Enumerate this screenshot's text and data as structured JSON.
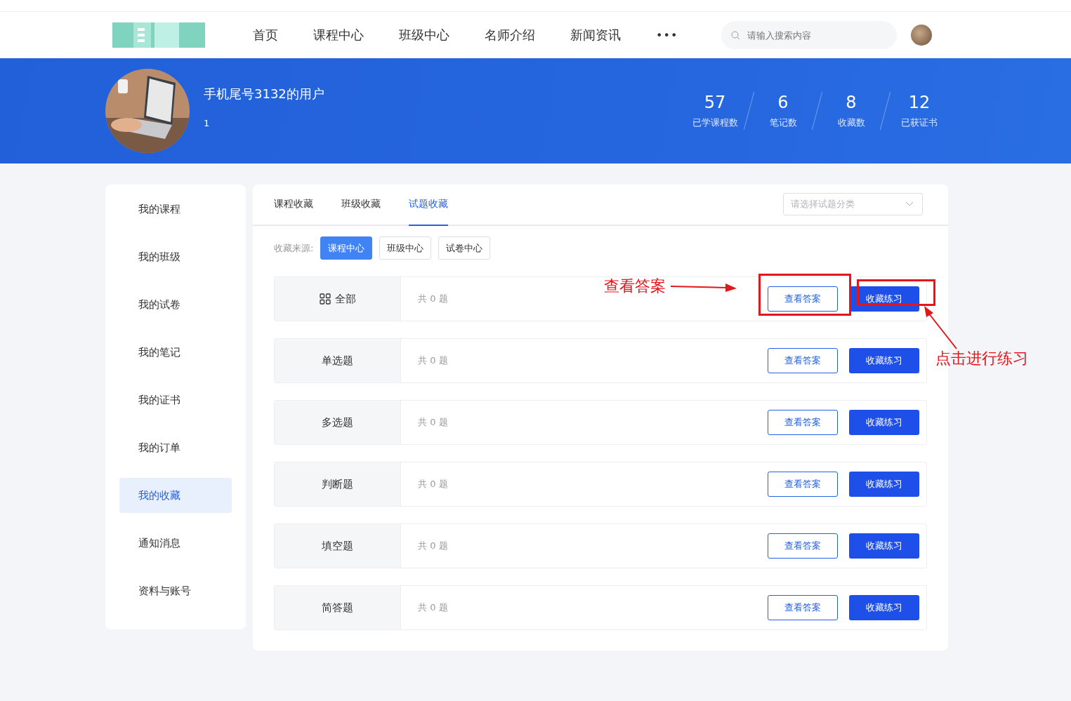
{
  "nav": {
    "items": [
      {
        "label": "首页",
        "selected": false
      },
      {
        "label": "课程中心",
        "selected": false
      },
      {
        "label": "班级中心",
        "selected": false
      },
      {
        "label": "名师介绍",
        "selected": false
      },
      {
        "label": "新闻资讯",
        "selected": false
      }
    ],
    "more": "•••",
    "search_placeholder": "请输入搜索内容"
  },
  "profile": {
    "name": "手机尾号3132的用户",
    "sub": "1",
    "stats": [
      {
        "value": "57",
        "label": "已学课程数"
      },
      {
        "value": "6",
        "label": "笔记数"
      },
      {
        "value": "8",
        "label": "收藏数"
      },
      {
        "value": "12",
        "label": "已获证书"
      }
    ]
  },
  "sidebar": [
    {
      "label": "我的课程",
      "selected": false
    },
    {
      "label": "我的班级",
      "selected": false
    },
    {
      "label": "我的试卷",
      "selected": false
    },
    {
      "label": "我的笔记",
      "selected": false
    },
    {
      "label": "我的证书",
      "selected": false
    },
    {
      "label": "我的订单",
      "selected": false
    },
    {
      "label": "我的收藏",
      "selected": true
    },
    {
      "label": "通知消息",
      "selected": false
    },
    {
      "label": "资料与账号",
      "selected": false
    }
  ],
  "tabs": [
    {
      "label": "课程收藏",
      "selected": false
    },
    {
      "label": "班级收藏",
      "selected": false
    },
    {
      "label": "试题收藏",
      "selected": true
    }
  ],
  "category_select": {
    "placeholder": "请选择试题分类"
  },
  "source": {
    "label": "收藏来源:",
    "options": [
      {
        "label": "课程中心",
        "selected": true
      },
      {
        "label": "班级中心",
        "selected": false
      },
      {
        "label": "试卷中心",
        "selected": false
      }
    ]
  },
  "rows": [
    {
      "name": "全部",
      "icon": true,
      "count": "共 0 题",
      "view": "查看答案",
      "practice": "收藏练习"
    },
    {
      "name": "单选题",
      "icon": false,
      "count": "共 0 题",
      "view": "查看答案",
      "practice": "收藏练习"
    },
    {
      "name": "多选题",
      "icon": false,
      "count": "共 0 题",
      "view": "查看答案",
      "practice": "收藏练习"
    },
    {
      "name": "判断题",
      "icon": false,
      "count": "共 0 题",
      "view": "查看答案",
      "practice": "收藏练习"
    },
    {
      "name": "填空题",
      "icon": false,
      "count": "共 0 题",
      "view": "查看答案",
      "practice": "收藏练习"
    },
    {
      "name": "简答题",
      "icon": false,
      "count": "共 0 题",
      "view": "查看答案",
      "practice": "收藏练习"
    }
  ],
  "annotations": [
    "查看答案",
    "点击进行练习"
  ]
}
